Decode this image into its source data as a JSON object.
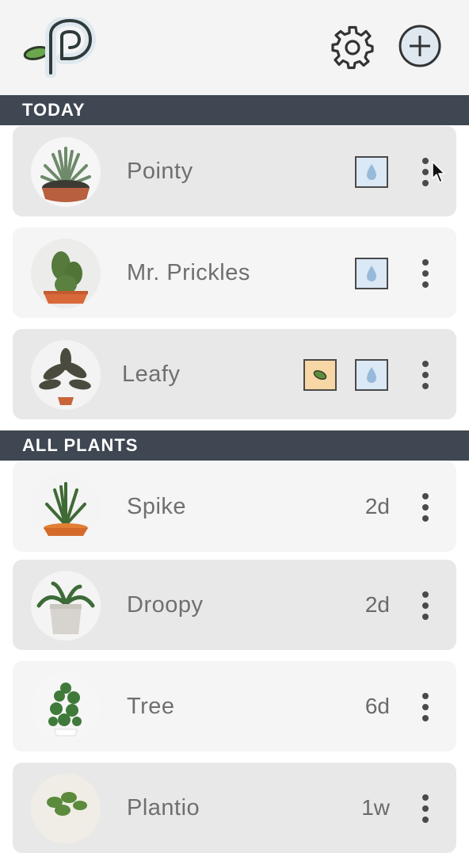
{
  "header": {
    "add_label": "",
    "settings_label": ""
  },
  "sections": {
    "today": "TODAY",
    "all_plants": "ALL PLANTS"
  },
  "today_plants": [
    {
      "name": "Pointy",
      "tasks": [
        "water"
      ],
      "selected": true
    },
    {
      "name": "Mr. Prickles",
      "tasks": [
        "water"
      ],
      "selected": false
    },
    {
      "name": "Leafy",
      "tasks": [
        "fertilize",
        "water"
      ],
      "selected": false
    }
  ],
  "all_plants": [
    {
      "name": "Spike",
      "days": "2d"
    },
    {
      "name": "Droopy",
      "days": "2d"
    },
    {
      "name": "Tree",
      "days": "6d"
    },
    {
      "name": "Plantio",
      "days": "1w"
    }
  ],
  "icons": {
    "logo": "plant-p-logo-icon",
    "settings": "gear-icon",
    "add": "plus-circle-icon",
    "water": "water-drop-icon",
    "fertilize": "leaf-icon",
    "menu": "more-vertical-icon"
  },
  "colors": {
    "section_bg": "#3e4752",
    "water_task": "#dbe8f5",
    "fertilize_task": "#f7d7a5",
    "leaf_green": "#5e8f3f"
  }
}
